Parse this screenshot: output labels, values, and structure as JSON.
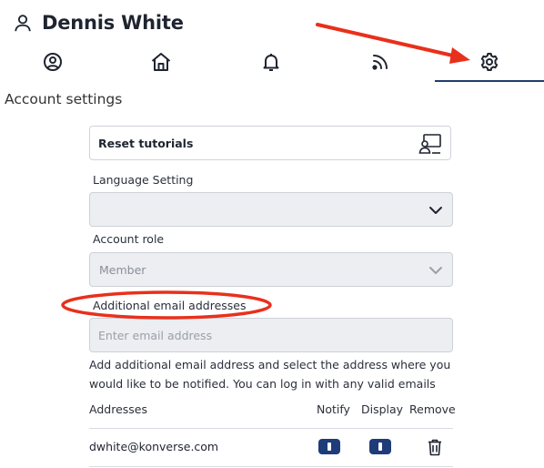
{
  "header": {
    "name": "Dennis White",
    "icon": "user-icon"
  },
  "tabs": [
    {
      "name": "profile",
      "icon": "user-circle-icon"
    },
    {
      "name": "home",
      "icon": "home-icon"
    },
    {
      "name": "notifications",
      "icon": "bell-icon"
    },
    {
      "name": "feed",
      "icon": "rss-icon"
    },
    {
      "name": "settings",
      "icon": "gear-icon",
      "active": true
    }
  ],
  "section_title": "Account settings",
  "reset_tutorials": {
    "label": "Reset tutorials",
    "icon": "tutorial-icon"
  },
  "language": {
    "label": "Language Setting",
    "value": ""
  },
  "role": {
    "label": "Account role",
    "value": "Member"
  },
  "emails": {
    "label": "Additional email addresses",
    "placeholder": "Enter email address",
    "help": "Add additional email address and select the address where you would like to be notified. You can log in with any valid emails"
  },
  "table": {
    "headers": {
      "addresses": "Addresses",
      "notify": "Notify",
      "display": "Display",
      "remove": "Remove"
    },
    "rows": [
      {
        "address": "dwhite@konverse.com",
        "notify": true,
        "display": true
      }
    ]
  },
  "colors": {
    "accent": "#1f3c7a",
    "annotation": "#e8301c"
  }
}
